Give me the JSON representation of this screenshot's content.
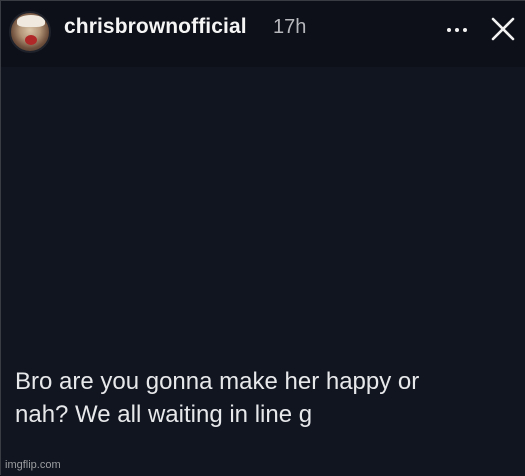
{
  "story": {
    "username": "chrisbrownofficial",
    "timestamp": "17h",
    "post_text": "Bro are you gonna make her happy or\nnah? We all waiting in line g",
    "more_icon": "more-horizontal-icon",
    "close_icon": "close-icon"
  },
  "watermark": "imgflip.com",
  "colors": {
    "background": "#101520",
    "header": "#0d1018",
    "text": "#e7e8ea",
    "muted": "#b6b7bd"
  }
}
